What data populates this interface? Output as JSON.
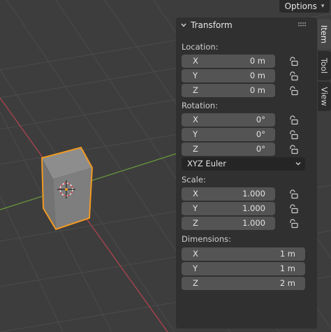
{
  "header": {
    "options_label": "Options"
  },
  "panel": {
    "title": "Transform",
    "location": {
      "label": "Location:",
      "x": {
        "axis": "X",
        "value": "0 m"
      },
      "y": {
        "axis": "Y",
        "value": "0 m"
      },
      "z": {
        "axis": "Z",
        "value": "0 m"
      }
    },
    "rotation": {
      "label": "Rotation:",
      "x": {
        "axis": "X",
        "value": "0°"
      },
      "y": {
        "axis": "Y",
        "value": "0°"
      },
      "z": {
        "axis": "Z",
        "value": "0°"
      },
      "mode": "XYZ Euler"
    },
    "scale": {
      "label": "Scale:",
      "x": {
        "axis": "X",
        "value": "1.000"
      },
      "y": {
        "axis": "Y",
        "value": "1.000"
      },
      "z": {
        "axis": "Z",
        "value": "1.000"
      }
    },
    "dimensions": {
      "label": "Dimensions:",
      "x": {
        "axis": "X",
        "value": "1 m"
      },
      "y": {
        "axis": "Y",
        "value": "1 m"
      },
      "z": {
        "axis": "Z",
        "value": "2 m"
      }
    }
  },
  "tabs": [
    {
      "label": "Item"
    },
    {
      "label": "Tool"
    },
    {
      "label": "View"
    }
  ],
  "colors": {
    "viewport_bg": "#3d3d3d",
    "grid": "#4a4a4a",
    "x_axis": "#b8434f",
    "y_axis": "#6b9a3a",
    "selection_outline": "#f29a22",
    "panel_bg": "#303030",
    "field_bg": "#545454"
  },
  "icons": [
    "collapse-chevron-icon",
    "drag-handle-icon",
    "padlock-icon",
    "dropdown-chevron-icon",
    "origin-cursor-icon"
  ]
}
